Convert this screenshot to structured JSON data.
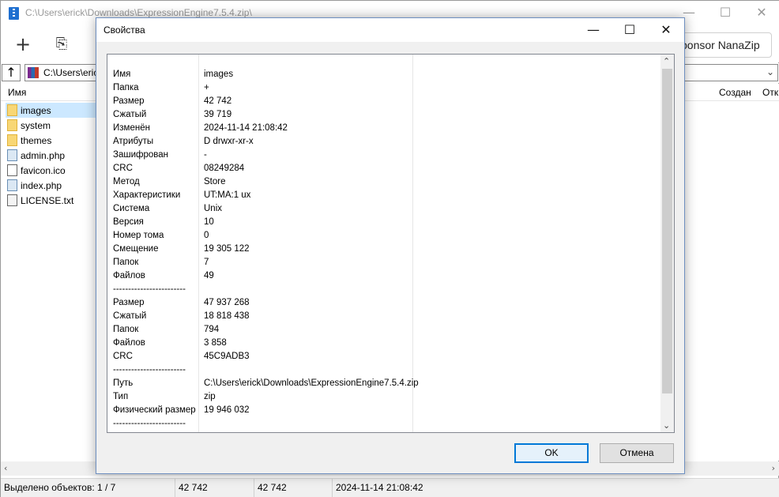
{
  "main_window": {
    "title": "C:\\Users\\erick\\Downloads\\ExpressionEngine7.5.4.zip\\",
    "sponsor_label": "ponsor NanaZip",
    "address": "C:\\Users\\eric",
    "columns": [
      "Имя",
      "Создан",
      "Отк"
    ],
    "files": [
      {
        "name": "images",
        "type": "folder",
        "selected": true
      },
      {
        "name": "system",
        "type": "folder"
      },
      {
        "name": "themes",
        "type": "folder"
      },
      {
        "name": "admin.php",
        "type": "php"
      },
      {
        "name": "favicon.ico",
        "type": "ico"
      },
      {
        "name": "index.php",
        "type": "php"
      },
      {
        "name": "LICENSE.txt",
        "type": "txt"
      }
    ],
    "status": {
      "selected": "Выделено объектов: 1 / 7",
      "size": "42 742",
      "packed": "42 742",
      "modified": "2024-11-14 21:08:42"
    }
  },
  "dialog": {
    "title": "Свойства",
    "ok_label": "OK",
    "cancel_label": "Отмена",
    "properties": [
      {
        "name": "",
        "value": ""
      },
      {
        "name": "Имя",
        "value": "images"
      },
      {
        "name": "Папка",
        "value": "+"
      },
      {
        "name": "Размер",
        "value": "42 742"
      },
      {
        "name": "Сжатый",
        "value": "39 719"
      },
      {
        "name": "Изменён",
        "value": "2024-11-14 21:08:42"
      },
      {
        "name": "Атрибуты",
        "value": "D drwxr-xr-x"
      },
      {
        "name": "Зашифрован",
        "value": "-"
      },
      {
        "name": "CRC",
        "value": "08249284"
      },
      {
        "name": "Метод",
        "value": "Store"
      },
      {
        "name": "Характеристики",
        "value": "UT:MA:1 ux"
      },
      {
        "name": "Система",
        "value": "Unix"
      },
      {
        "name": "Версия",
        "value": "10"
      },
      {
        "name": "Номер тома",
        "value": "0"
      },
      {
        "name": "Смещение",
        "value": "19 305 122"
      },
      {
        "name": "Папок",
        "value": "7"
      },
      {
        "name": "Файлов",
        "value": "49"
      },
      {
        "name": "------------------------",
        "value": ""
      },
      {
        "name": "Размер",
        "value": "47 937 268"
      },
      {
        "name": "Сжатый",
        "value": "18 818 438"
      },
      {
        "name": "Папок",
        "value": "794"
      },
      {
        "name": "Файлов",
        "value": "3 858"
      },
      {
        "name": "CRC",
        "value": "45C9ADB3"
      },
      {
        "name": "------------------------",
        "value": ""
      },
      {
        "name": "Путь",
        "value": "C:\\Users\\erick\\Downloads\\ExpressionEngine7.5.4.zip"
      },
      {
        "name": "Тип",
        "value": "zip"
      },
      {
        "name": "Физический размер",
        "value": "19 946 032"
      },
      {
        "name": "------------------------",
        "value": ""
      }
    ]
  },
  "icons": {
    "add": "plus-icon",
    "extract": "extract-icon",
    "up": "up-arrow-icon",
    "minimize": "minimize-icon",
    "maximize": "maximize-icon",
    "close": "close-icon"
  }
}
